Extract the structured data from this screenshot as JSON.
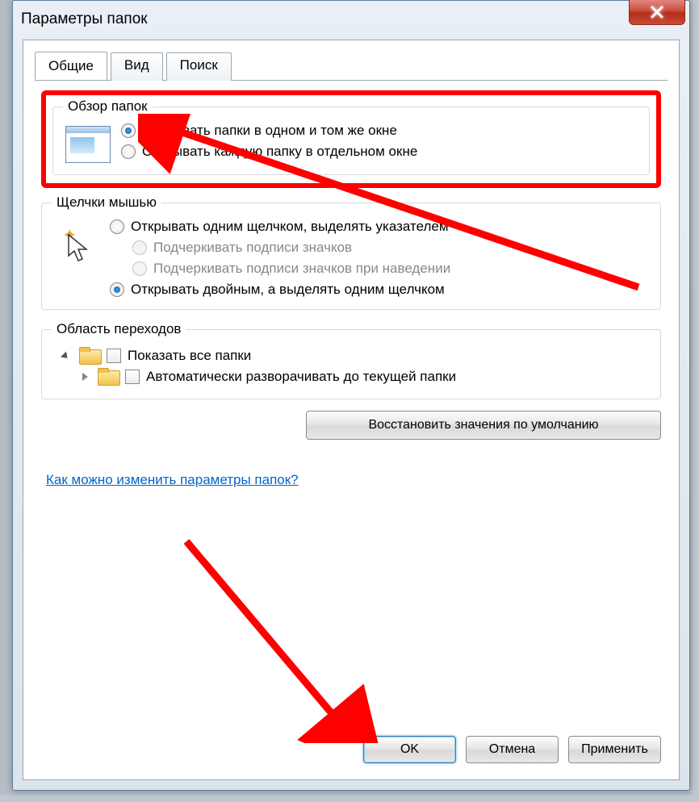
{
  "window": {
    "title": "Параметры папок"
  },
  "tabs": {
    "general": "Общие",
    "view": "Вид",
    "search": "Поиск"
  },
  "group_browse": {
    "legend": "Обзор папок",
    "opt_same_window": "Открывать папки в одном и том же окне",
    "opt_new_window": "Открывать каждую папку в отдельном окне"
  },
  "group_click": {
    "legend": "Щелчки мышью",
    "opt_single_click": "Открывать одним щелчком, выделять указателем",
    "opt_underline_always": "Подчеркивать подписи значков",
    "opt_underline_hover": "Подчеркивать подписи значков при наведении",
    "opt_double_click": "Открывать двойным, а выделять одним щелчком"
  },
  "group_nav": {
    "legend": "Область переходов",
    "opt_show_all": "Показать все папки",
    "opt_auto_expand": "Автоматически разворачивать до текущей папки"
  },
  "buttons": {
    "restore_defaults": "Восстановить значения по умолчанию",
    "ok": "OK",
    "cancel": "Отмена",
    "apply": "Применить"
  },
  "link": {
    "help": "Как можно изменить параметры папок?"
  }
}
